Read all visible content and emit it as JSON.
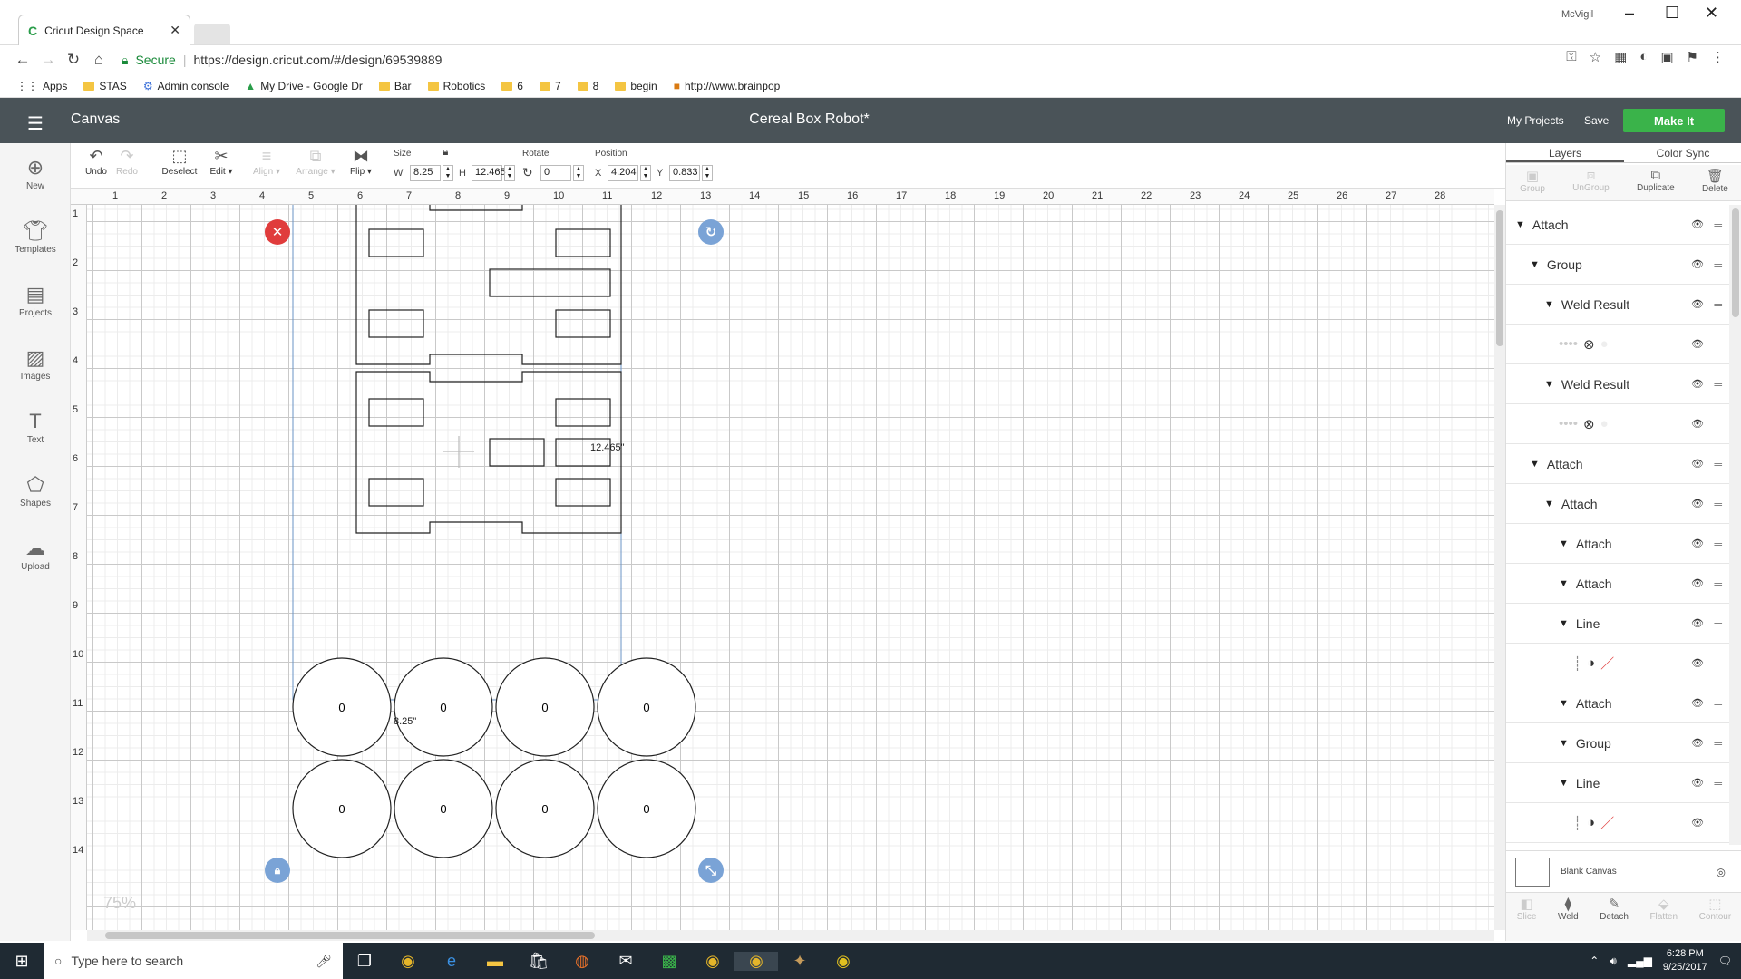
{
  "browser": {
    "tab_title": "Cricut Design Space",
    "user": "McVigil",
    "secure_label": "Secure",
    "url": "https://design.cricut.com/#/design/69539889",
    "bookmarks": [
      "Apps",
      "STAS",
      "Admin console",
      "My Drive - Google Dr",
      "Bar",
      "Robotics",
      "6",
      "7",
      "8",
      "begin",
      "http://www.brainpop"
    ]
  },
  "app": {
    "section": "Canvas",
    "project_title": "Cereal Box Robot*",
    "my_projects": "My Projects",
    "save": "Save",
    "make_it": "Make It"
  },
  "leftnav": [
    {
      "label": "New",
      "icon": "plus-circle-icon"
    },
    {
      "label": "Templates",
      "icon": "shirt-icon"
    },
    {
      "label": "Projects",
      "icon": "projects-icon"
    },
    {
      "label": "Images",
      "icon": "image-icon"
    },
    {
      "label": "Text",
      "icon": "text-icon"
    },
    {
      "label": "Shapes",
      "icon": "shapes-icon"
    },
    {
      "label": "Upload",
      "icon": "upload-icon"
    }
  ],
  "toolbar": {
    "undo": "Undo",
    "redo": "Redo",
    "deselect": "Deselect",
    "edit": "Edit",
    "align": "Align",
    "arrange": "Arrange",
    "flip": "Flip",
    "size_label": "Size",
    "w_label": "W",
    "w_value": "8.25",
    "h_label": "H",
    "h_value": "12.465",
    "rotate_label": "Rotate",
    "rotate_value": "0",
    "position_label": "Position",
    "x_label": "X",
    "x_value": "4.204",
    "y_label": "Y",
    "y_value": "0.833"
  },
  "canvas": {
    "ruler_top": [
      "1",
      "2",
      "3",
      "4",
      "5",
      "6",
      "7",
      "8",
      "9",
      "10",
      "11",
      "12",
      "13",
      "14",
      "15",
      "16",
      "17",
      "18",
      "19",
      "20",
      "21",
      "22",
      "23",
      "24",
      "25",
      "26",
      "27",
      "28"
    ],
    "ruler_left": [
      "1",
      "2",
      "3",
      "4",
      "5",
      "6",
      "7",
      "8",
      "9",
      "10",
      "11",
      "12",
      "13",
      "14"
    ],
    "height_label": "12.465\"",
    "width_label": "8.25\"",
    "zoom": "75%",
    "circle_label": "0"
  },
  "layers_panel": {
    "tab_layers": "Layers",
    "tab_colorsync": "Color Sync",
    "actions": [
      "Group",
      "UnGroup",
      "Duplicate",
      "Delete"
    ],
    "items": [
      {
        "label": "Attach",
        "indent": 0
      },
      {
        "label": "Group",
        "indent": 1
      },
      {
        "label": "Weld Result",
        "indent": 2
      },
      {
        "label": "",
        "indent": 3,
        "thumb": true
      },
      {
        "label": "Weld Result",
        "indent": 2
      },
      {
        "label": "",
        "indent": 3,
        "thumb": true
      },
      {
        "label": "Attach",
        "indent": 1
      },
      {
        "label": "Attach",
        "indent": 2
      },
      {
        "label": "Attach",
        "indent": 3
      },
      {
        "label": "Attach",
        "indent": 3
      },
      {
        "label": "Line",
        "indent": 3
      },
      {
        "label": "",
        "indent": 4,
        "thumb": true,
        "line": true
      },
      {
        "label": "Attach",
        "indent": 3
      },
      {
        "label": "Group",
        "indent": 3
      },
      {
        "label": "Line",
        "indent": 3
      },
      {
        "label": "",
        "indent": 4,
        "thumb": true,
        "line": true
      }
    ],
    "blank_canvas": "Blank Canvas",
    "bottom_actions": [
      "Slice",
      "Weld",
      "Detach",
      "Flatten",
      "Contour"
    ]
  },
  "taskbar": {
    "search_placeholder": "Type here to search",
    "time": "6:28 PM",
    "date": "9/25/2017"
  }
}
